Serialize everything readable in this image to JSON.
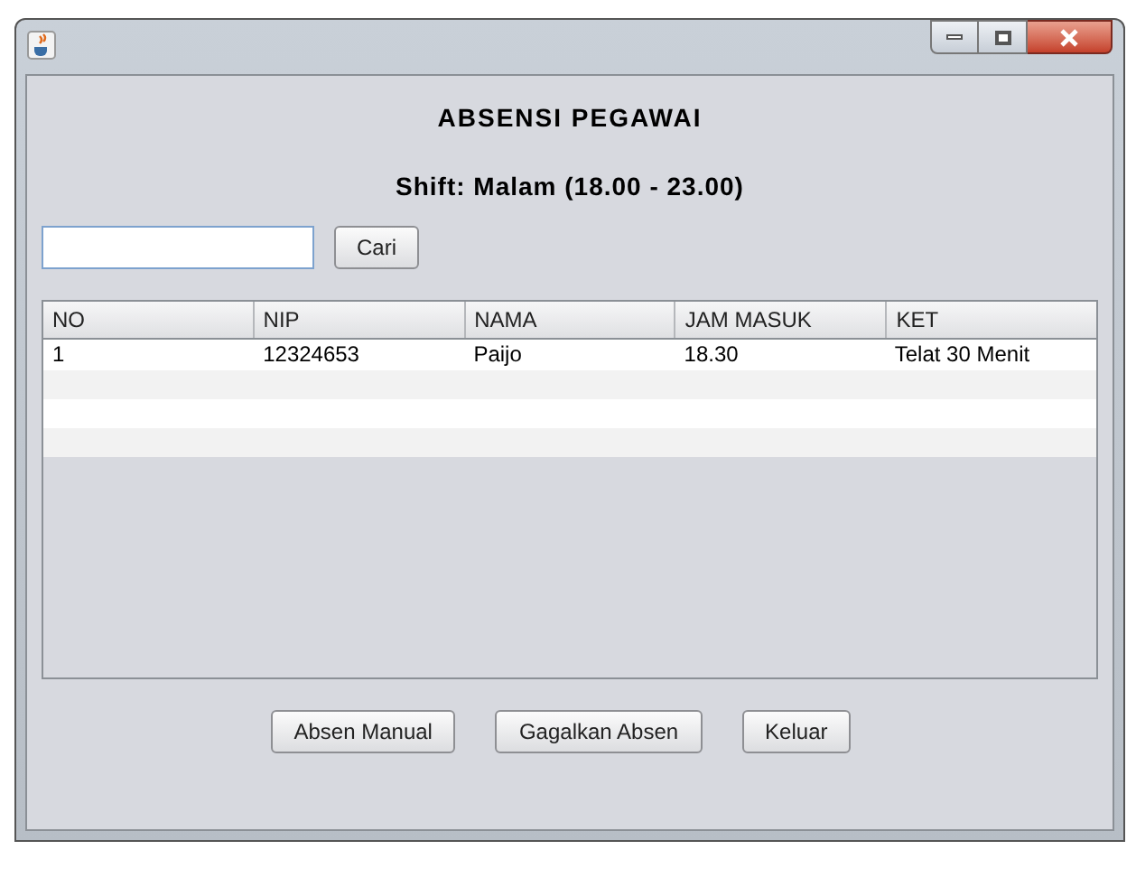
{
  "heading": "ABSENSI PEGAWAI",
  "shift": "Shift: Malam (18.00 - 23.00)",
  "search": {
    "button": "Cari"
  },
  "table": {
    "columns": [
      "NO",
      "NIP",
      "NAMA",
      "JAM MASUK",
      "KET"
    ],
    "rows": [
      [
        "1",
        "12324653",
        "Paijo",
        "18.30",
        "Telat 30 Menit"
      ]
    ]
  },
  "buttons": [
    "Absen Manual",
    "Gagalkan Absen",
    "Keluar"
  ]
}
